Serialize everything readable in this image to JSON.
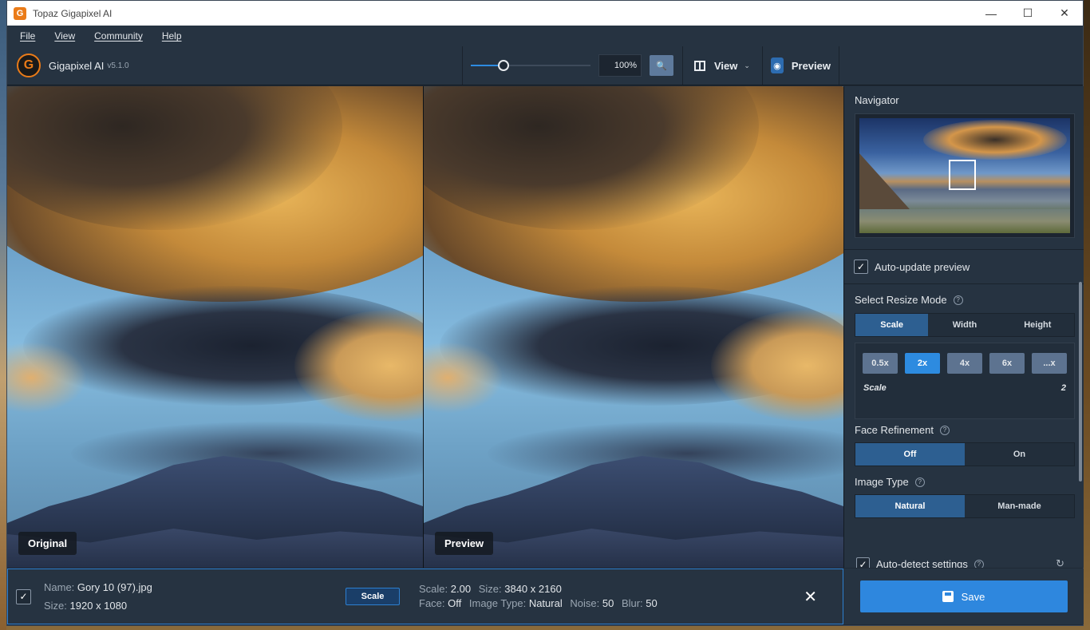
{
  "window": {
    "title": "Topaz Gigapixel AI",
    "app_icon_letter": "G",
    "minimize": "—",
    "maximize": "☐",
    "close": "✕"
  },
  "menu": [
    "File",
    "View",
    "Community",
    "Help"
  ],
  "toolbar": {
    "app_name": "Gigapixel AI",
    "version": "v5.1.0",
    "zoom_percent": "100%",
    "zoom_slider_fraction": 0.27,
    "view_label": "View",
    "preview_label": "Preview"
  },
  "panes": {
    "original_label": "Original",
    "preview_label": "Preview"
  },
  "panel": {
    "navigator_title": "Navigator",
    "auto_update_label": "Auto-update preview",
    "resize_mode_title": "Select Resize Mode",
    "resize_modes": [
      "Scale",
      "Width",
      "Height"
    ],
    "resize_mode_active": 0,
    "scale_options": [
      "0.5x",
      "2x",
      "4x",
      "6x",
      "...x"
    ],
    "scale_active": 1,
    "scale_label": "Scale",
    "scale_value": "2",
    "face_title": "Face Refinement",
    "face_options": [
      "Off",
      "On"
    ],
    "face_active": 0,
    "image_type_title": "Image Type",
    "image_type_options": [
      "Natural",
      "Man-made"
    ],
    "image_type_active": 0,
    "auto_detect_label": "Auto-detect settings"
  },
  "bottom": {
    "name_key": "Name:",
    "name_value": "Gory 10 (97).jpg",
    "size_key": "Size:",
    "size_value": "1920 x 1080",
    "scale_tag": "Scale",
    "out_scale_key": "Scale:",
    "out_scale_value": "2.00",
    "out_size_key": "Size:",
    "out_size_value": "3840 x 2160",
    "face_key": "Face:",
    "face_value": "Off",
    "type_key": "Image Type:",
    "type_value": "Natural",
    "noise_key": "Noise:",
    "noise_value": "50",
    "blur_key": "Blur:",
    "blur_value": "50"
  },
  "save_label": "Save",
  "icons": {
    "check": "✓",
    "help": "?",
    "close": "✕",
    "refresh": "↻",
    "chevron": "⌄",
    "eye": "◉",
    "magnifier": "🔍"
  }
}
